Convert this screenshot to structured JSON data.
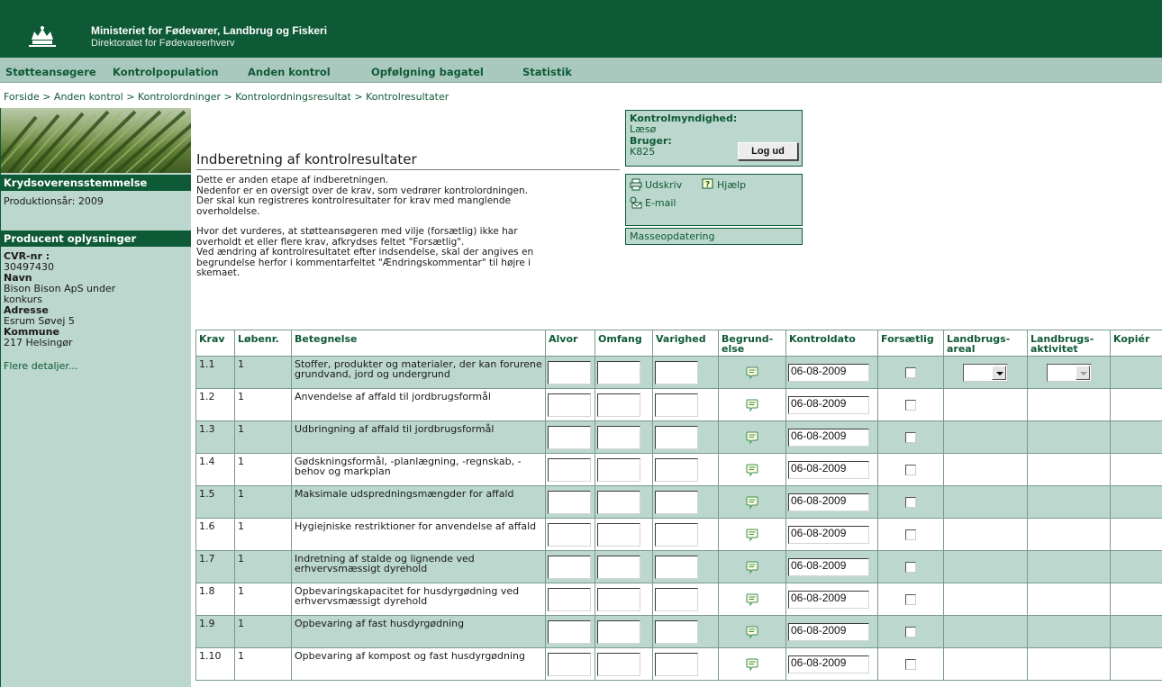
{
  "header": {
    "ministry": "Ministeriet for Fødevarer, Landbrug og Fiskeri",
    "directorate": "Direktoratet for Fødevareerhverv"
  },
  "nav": [
    {
      "label": "Støtteansøgere"
    },
    {
      "label": "Kontrolpopulation"
    },
    {
      "label": "Anden kontrol"
    },
    {
      "label": "Opfølgning bagatel"
    },
    {
      "label": "Statistik"
    }
  ],
  "breadcrumb": "Forside > Anden kontrol > Kontrolordninger > Kontrolordningsresultat > Kontrolresultater",
  "sidebar": {
    "section1_title": "Krydsoverensstemmelse",
    "production_year": "Produktionsår: 2009",
    "section2_title": "Producent oplysninger",
    "cvr_label": "CVR-nr :",
    "cvr_value": "30497430",
    "name_label": "Navn",
    "name_line1": "Bison Bison ApS under",
    "name_line2": "konkurs",
    "address_label": "Adresse",
    "address_value": "Esrum Søvej 5",
    "municipality_label": "Kommune",
    "municipality_value": "217 Helsingør",
    "more_details": "Flere detaljer..."
  },
  "main": {
    "title": "Indberetning af kontrolresultater",
    "intro1_l1": "Dette er anden etape af indberetningen.",
    "intro1_l2": "Nedenfor er en oversigt over de krav, som vedrører kontrolordningen.",
    "intro1_l3": "Der skal kun registreres kontrolresultater for krav med manglende",
    "intro1_l4": "overholdelse.",
    "intro2_l1": "Hvor det vurderes, at støtteansøgeren med vilje (forsætlig) ikke har",
    "intro2_l2": "overholdt et eller flere krav, afkrydses feltet \"Forsætlig\".",
    "intro2_l3": "Ved ændring af kontrolresultatet efter indsendelse, skal der angives en",
    "intro2_l4": "begrundelse herfor i kommentarfeltet \"Ændringskommentar\" til højre i",
    "intro2_l5": "skemaet."
  },
  "infobox": {
    "authority_label": "Kontrolmyndighed:",
    "authority_value": "Læsø",
    "user_label": "Bruger:",
    "user_value": "K825",
    "logout": "Log ud",
    "print": "Udskriv",
    "help": "Hjælp",
    "email": "E-mail",
    "mass_update": "Masseopdatering"
  },
  "table": {
    "headers": {
      "krav": "Krav",
      "lobenr": "Løbenr.",
      "betegnelse": "Betegnelse",
      "alvor": "Alvor",
      "omfang": "Omfang",
      "varighed": "Varighed",
      "begrundelse_l1": "Begrund-",
      "begrundelse_l2": "else",
      "kontroldato": "Kontroldato",
      "forsaetlig": "Forsætlig",
      "areal_l1": "Landbrugs-",
      "areal_l2": "areal",
      "aktivitet_l1": "Landbrugs-",
      "aktivitet_l2": "aktivitet",
      "kopier": "Kopiér"
    },
    "rows": [
      {
        "krav": "1.1",
        "lobenr": "1",
        "betegnelse": "Stoffer, produkter og materialer, der kan forurene grundvand, jord og undergrund",
        "kontroldato": "06-08-2009"
      },
      {
        "krav": "1.2",
        "lobenr": "1",
        "betegnelse": "Anvendelse af affald til jordbrugsformål",
        "kontroldato": "06-08-2009"
      },
      {
        "krav": "1.3",
        "lobenr": "1",
        "betegnelse": "Udbringning af affald til jordbrugsformål",
        "kontroldato": "06-08-2009"
      },
      {
        "krav": "1.4",
        "lobenr": "1",
        "betegnelse": "Gødskningsformål, -planlægning, -regnskab, -behov og markplan",
        "kontroldato": "06-08-2009"
      },
      {
        "krav": "1.5",
        "lobenr": "1",
        "betegnelse": "Maksimale udspredningsmængder for affald",
        "kontroldato": "06-08-2009"
      },
      {
        "krav": "1.6",
        "lobenr": "1",
        "betegnelse": "Hygiejniske restriktioner for anvendelse af affald",
        "kontroldato": "06-08-2009"
      },
      {
        "krav": "1.7",
        "lobenr": "1",
        "betegnelse": "Indretning af stalde og lignende ved erhvervsmæssigt dyrehold",
        "kontroldato": "06-08-2009"
      },
      {
        "krav": "1.8",
        "lobenr": "1",
        "betegnelse": "Opbevaringskapacitet for husdyrgødning ved erhvervsmæssigt dyrehold",
        "kontroldato": "06-08-2009"
      },
      {
        "krav": "1.9",
        "lobenr": "1",
        "betegnelse": "Opbevaring af fast husdyrgødning",
        "kontroldato": "06-08-2009"
      },
      {
        "krav": "1.10",
        "lobenr": "1",
        "betegnelse": "Opbevaring af kompost og fast husdyrgødning",
        "kontroldato": "06-08-2009"
      }
    ]
  },
  "colors": {
    "brand_dark_green": "#0f5a36",
    "light_green": "#bcd7cd",
    "nav_green": "#a9c9bf"
  },
  "icons": {
    "logo": "crown-logo-icon",
    "print": "printer-icon",
    "help": "help-icon",
    "email": "email-icon",
    "comment": "comment-icon"
  }
}
